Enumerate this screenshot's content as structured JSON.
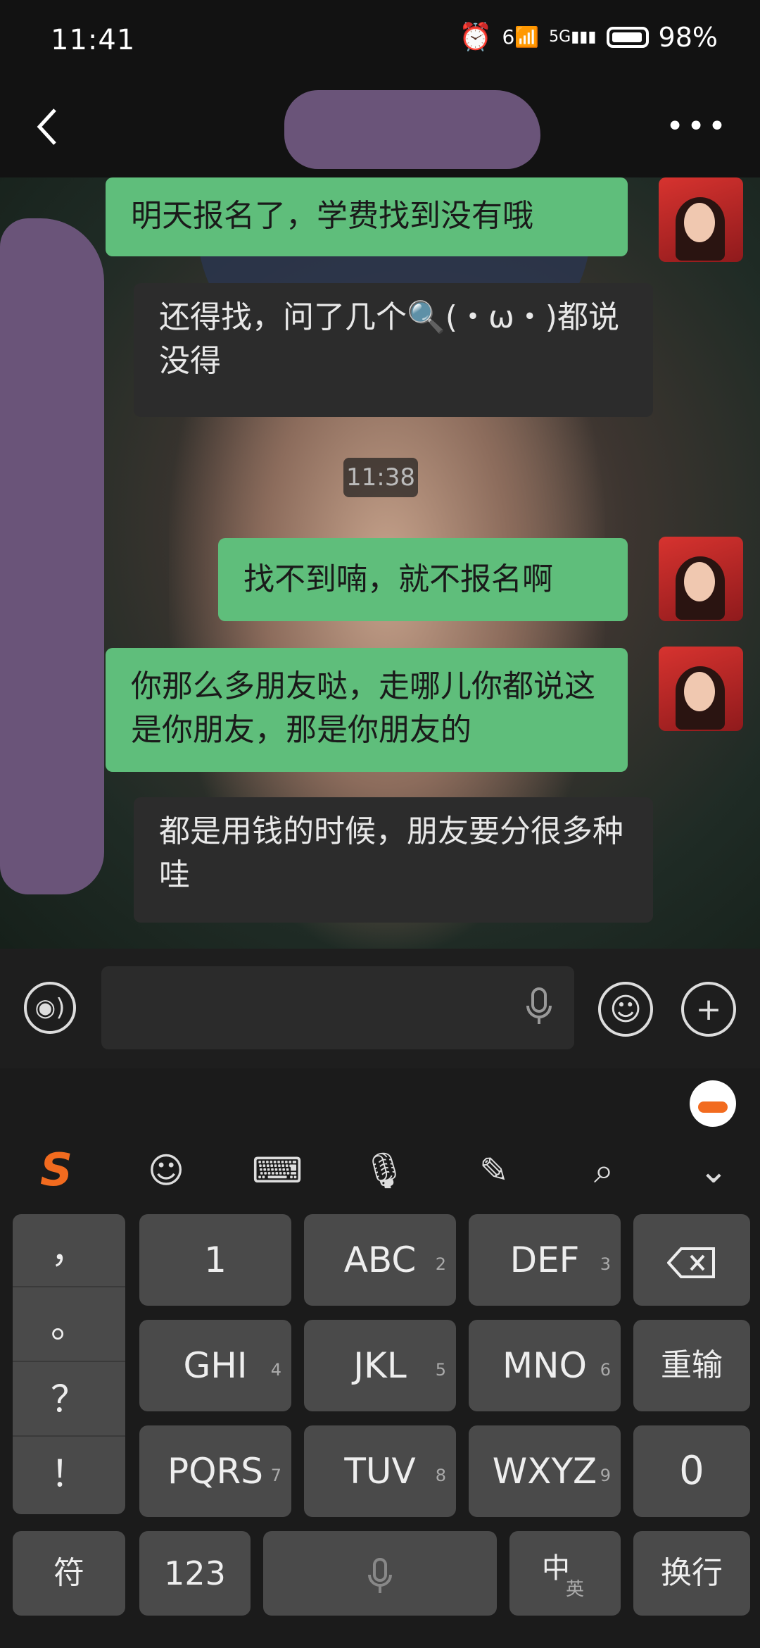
{
  "status": {
    "time": "11:41",
    "network": "6",
    "network5g": "5G",
    "battery": "98%"
  },
  "chat": {
    "timestamp": "11:38",
    "messages": [
      {
        "dir": "out",
        "text": "明天报名了，学费找到没有哦"
      },
      {
        "dir": "in",
        "text": "还得找，问了几个🔍(・ω・)都说没得"
      },
      {
        "dir": "out",
        "text": "找不到喃，就不报名啊"
      },
      {
        "dir": "out",
        "text": "你那么多朋友哒，走哪儿你都说这是你朋友，那是你朋友的"
      },
      {
        "dir": "in",
        "text": "都是用钱的时候，朋友要分很多种哇"
      }
    ]
  },
  "keyboard": {
    "punct": [
      "，",
      "。",
      "？",
      "！"
    ],
    "keys": [
      {
        "label": "1",
        "num": ""
      },
      {
        "label": "ABC",
        "num": "2"
      },
      {
        "label": "DEF",
        "num": "3"
      },
      {
        "label": "GHI",
        "num": "4"
      },
      {
        "label": "JKL",
        "num": "5"
      },
      {
        "label": "MNO",
        "num": "6"
      },
      {
        "label": "PQRS",
        "num": "7"
      },
      {
        "label": "TUV",
        "num": "8"
      },
      {
        "label": "WXYZ",
        "num": "9"
      }
    ],
    "reenter": "重输",
    "zero": "0",
    "symbols": "符",
    "numbers": "123",
    "lang_main": "中",
    "lang_sub": "英",
    "enter": "换行"
  },
  "icons": {
    "back": "chevron-left-icon",
    "more": "more-icon",
    "voice": "voice-icon",
    "mic": "mic-icon",
    "emoji": "emoji-icon",
    "plus": "plus-icon",
    "sogou": "sogou-logo",
    "keyboard": "keyboard-icon",
    "handwrite": "pen-icon",
    "search": "search-icon",
    "collapse": "chevron-down-icon",
    "backspace": "backspace-icon"
  },
  "colors": {
    "outgoing": "#5fbe7b",
    "incoming": "#2c2c2c",
    "sogou": "#f26b1f"
  }
}
